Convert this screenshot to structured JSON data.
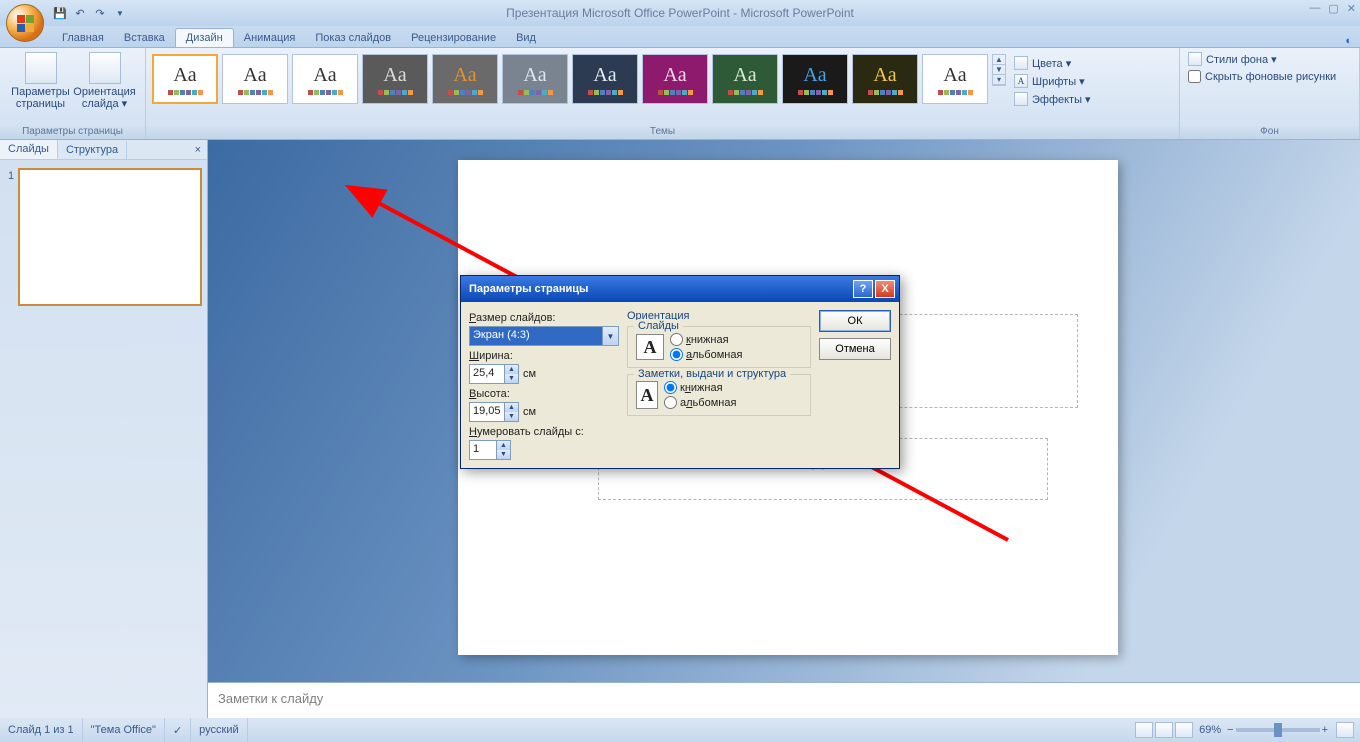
{
  "title": "Презентация Microsoft Office PowerPoint - Microsoft PowerPoint",
  "tabs": {
    "home": "Главная",
    "insert": "Вставка",
    "design": "Дизайн",
    "anim": "Анимация",
    "show": "Показ слайдов",
    "review": "Рецензирование",
    "view": "Вид"
  },
  "ribbon": {
    "pg_group": "Параметры страницы",
    "pg_btn": "Параметры страницы",
    "orient_btn": "Ориентация слайда ▾",
    "themes_group": "Темы",
    "colors": "Цвета ▾",
    "fonts": "Шрифты ▾",
    "effects": "Эффекты ▾",
    "bg_group": "Фон",
    "bg_styles": "Стили фона ▾",
    "bg_hide": "Скрыть фоновые рисунки"
  },
  "panel": {
    "slides": "Слайды",
    "outline": "Структура"
  },
  "slide": {
    "title_ph": "да",
    "subtitle_ph": "да"
  },
  "notes": "Заметки к слайду",
  "status": {
    "slide": "Слайд 1 из 1",
    "theme": "\"Тема Office\"",
    "lang": "русский",
    "zoom": "69%"
  },
  "dialog": {
    "title": "Параметры страницы",
    "size_lbl": "Размер слайдов:",
    "size_val": "Экран (4:3)",
    "width_lbl": "Ширина:",
    "width_val": "25,4",
    "unit": "см",
    "height_lbl": "Высота:",
    "height_val": "19,05",
    "number_lbl": "Нумеровать слайды с:",
    "number_val": "1",
    "orient_lbl": "Ориентация",
    "slides_lbl": "Слайды",
    "portrait": "книжная",
    "landscape": "альбомная",
    "notes_lbl": "Заметки, выдачи и структура",
    "ok": "ОК",
    "cancel": "Отмена"
  }
}
